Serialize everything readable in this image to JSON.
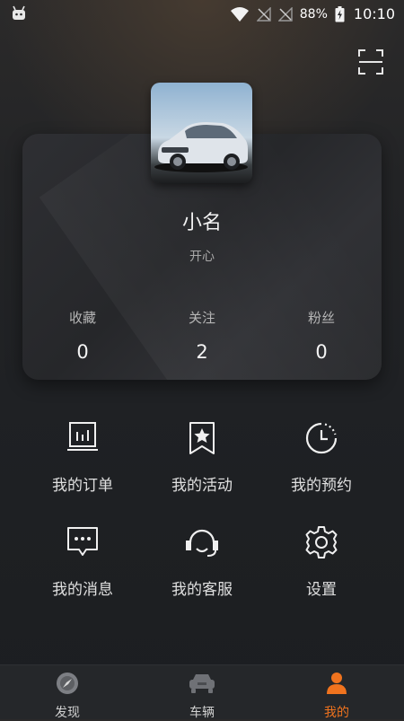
{
  "status_bar": {
    "battery": "88%",
    "time": "10:10"
  },
  "profile": {
    "name": "小名",
    "signature": "开心",
    "stats": [
      {
        "label": "收藏",
        "value": "0"
      },
      {
        "label": "关注",
        "value": "2"
      },
      {
        "label": "粉丝",
        "value": "0"
      }
    ]
  },
  "menu": [
    {
      "label": "我的订单",
      "icon": "orders-icon"
    },
    {
      "label": "我的活动",
      "icon": "bookmark-star-icon"
    },
    {
      "label": "我的预约",
      "icon": "clock-icon"
    },
    {
      "label": "我的消息",
      "icon": "message-icon"
    },
    {
      "label": "我的客服",
      "icon": "headset-icon"
    },
    {
      "label": "设置",
      "icon": "gear-icon"
    }
  ],
  "bottom_nav": [
    {
      "label": "发现",
      "icon": "compass-icon"
    },
    {
      "label": "车辆",
      "icon": "car-icon"
    },
    {
      "label": "我的",
      "icon": "user-icon",
      "active": true
    }
  ],
  "colors": {
    "accent": "#f0731e",
    "background": "#1f2124",
    "card": "#2b2c30"
  }
}
